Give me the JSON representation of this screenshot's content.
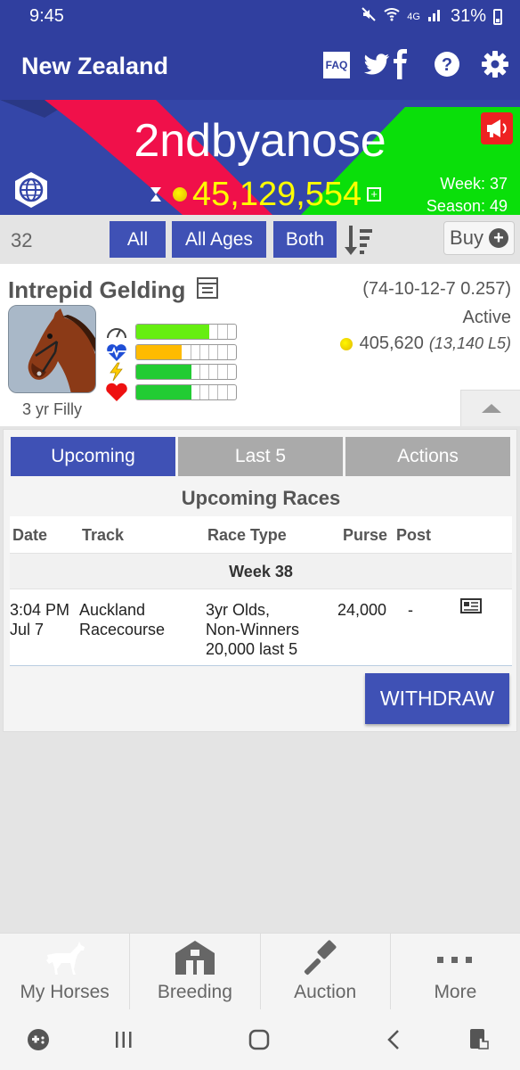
{
  "status_bar": {
    "time": "9:45",
    "network": "4G",
    "battery": "31%"
  },
  "app_bar": {
    "title": "New Zealand",
    "faq_label": "FAQ"
  },
  "banner": {
    "stable_name": "2ndbyanose",
    "balance": "45,129,554",
    "week_label": "Week: 37",
    "season_label": "Season: 49"
  },
  "filters": {
    "count": "32",
    "breed_label": "All",
    "age_label": "All Ages",
    "sex_label": "Both",
    "buy_label": "Buy"
  },
  "horse": {
    "name": "Intrepid Gelding",
    "record": "(74-10-12-7 0.257)",
    "status": "Active",
    "earnings": "405,620",
    "last5": "(13,140 L5)",
    "age_sex": "3 yr Filly",
    "stats": [
      {
        "icon": "speedometer-icon",
        "filled": 8,
        "total": 11,
        "color": "#66ee11"
      },
      {
        "icon": "heartbeat-icon",
        "filled": 5,
        "total": 11,
        "color": "#ffbb00"
      },
      {
        "icon": "lightning-icon",
        "filled": 6,
        "total": 11,
        "color": "#22cc33"
      },
      {
        "icon": "heart-icon",
        "filled": 6,
        "total": 11,
        "color": "#22cc33"
      }
    ]
  },
  "details": {
    "tabs": [
      "Upcoming",
      "Last 5",
      "Actions"
    ],
    "active_tab": 0,
    "panel_title": "Upcoming Races",
    "columns": [
      "Date",
      "Track",
      "Race Type",
      "Purse",
      "Post"
    ],
    "week_header": "Week 38",
    "races": [
      {
        "date": "3:04 PM\nJul 7",
        "track": "Auckland\nRacecourse",
        "race_type": "3yr Olds,\nNon-Winners\n20,000 last 5",
        "purse": "24,000",
        "post": "-"
      }
    ],
    "withdraw_label": "WITHDRAW"
  },
  "bottom_nav": {
    "items": [
      "My Horses",
      "Breeding",
      "Auction",
      "More"
    ],
    "active": 0
  },
  "colors": {
    "primary": "#303f9f",
    "button": "#3f51b5",
    "money": "#ffff00",
    "banner_red": "#f0104a",
    "banner_green": "#0adf0a"
  }
}
